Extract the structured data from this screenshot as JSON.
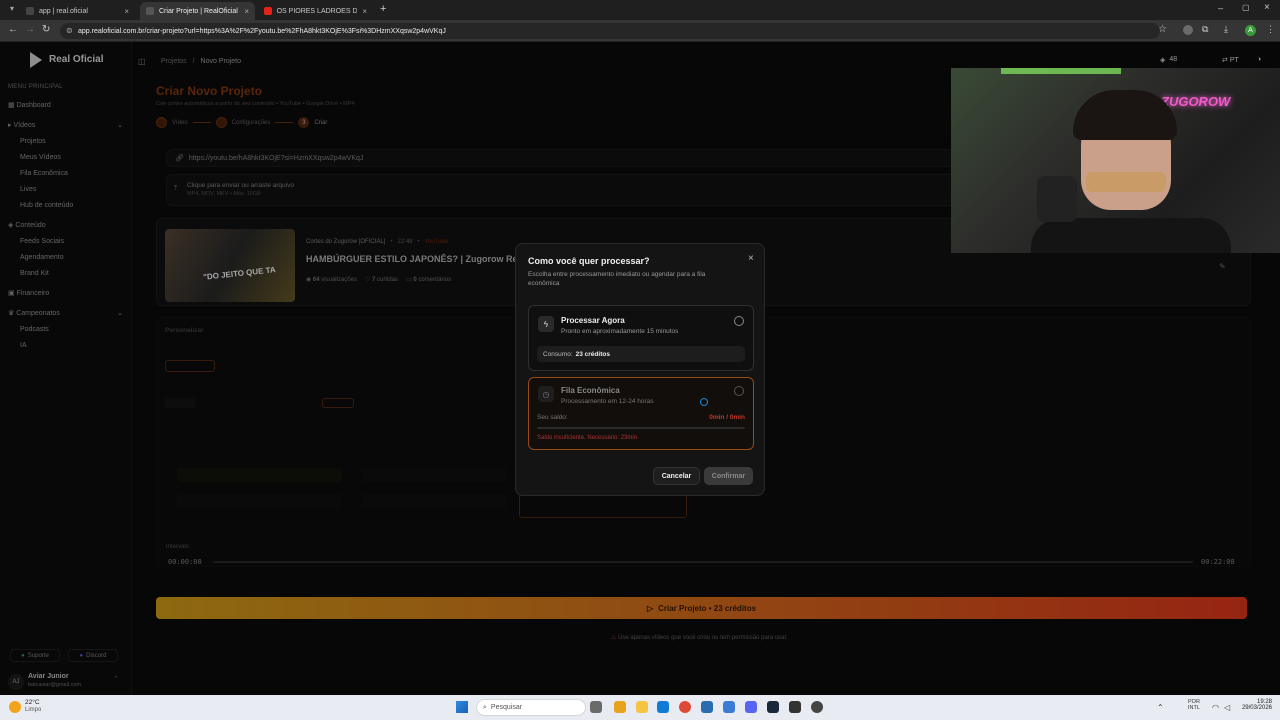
{
  "browser": {
    "tabs": [
      {
        "title": "app | real.oficial"
      },
      {
        "title": "Criar Projeto | RealOficial"
      },
      {
        "title": "OS PIORES LADRÕES DE BANC"
      }
    ],
    "url": "app.realoficial.com.br/criar-projeto?url=https%3A%2F%2Fyoutu.be%2FhA8hkt3KOjE%3Fsi%3DHzmXXqsw2p4wVKqJ",
    "profile_initial": "A"
  },
  "sidebar": {
    "brand": "Real Oficial",
    "section": "MENU PRINCIPAL",
    "items": [
      "Dashboard",
      "Vídeos",
      "Projetos",
      "Meus Vídeos",
      "Fila Econômica",
      "Lives",
      "Hub de conteúdo",
      "Conteúdo",
      "Feeds Sociais",
      "Agendamento",
      "Brand Kit",
      "Financeiro",
      "Campeonatos",
      "Podcasts",
      "IA"
    ],
    "support": "Suporte",
    "discord": "Discord",
    "user_initials": "AJ",
    "user_name": "Aviar Junior",
    "user_email": "batcaviar@gmail.com"
  },
  "topbar": {
    "breadcrumb_root": "Projetos",
    "breadcrumb_sep": "/",
    "breadcrumb_current": "Novo Projeto",
    "credits": "48",
    "lang": "PT"
  },
  "page": {
    "title": "Criar Novo Projeto",
    "subtitle": "Crie cortes automáticos a partir do seu conteúdo • YouTube • Google Drive • MP4",
    "steps": [
      "Vídeo",
      "Configurações",
      "Criar"
    ],
    "step3_num": "3",
    "link_value": "https://youtu.be/hA8hkt3KOjE?si=HzmXXqsw2p4wVKqJ",
    "upload_title": "Clique para enviar ou arraste arquivo",
    "upload_sub": "MP4, MOV, MKV • Máx. 10GB",
    "video_channel": "Cortes do Zugorow [OFICIAL]",
    "video_duration": "22:48",
    "video_source": "YouTube",
    "video_title": "HAMBÚRGUER ESTILO JAPONÊS? | Zugorow Rea",
    "views": "64",
    "views_label": "visualizações",
    "likes": "7",
    "likes_label": "curtidas",
    "comments": "0",
    "comments_label": "comentários",
    "thumb_caption": "\"DO JEITO QUE TA",
    "customize_label": "Personalizar",
    "interval_label": "Intervalo",
    "time_start": "00:00:00",
    "time_end": "00:22:08",
    "cta_label": "Criar Projeto • 23 créditos",
    "warning": "Use apenas vídeos que você criou ou tem permissão para usar."
  },
  "modal": {
    "title": "Como você quer processar?",
    "subtitle": "Escolha entre processamento imediato ou agendar para a fila econômica",
    "close": "×",
    "opt1_title": "Processar Agora",
    "opt1_sub": "Pronto em aproximadamente 15 minutos",
    "opt1_cost_label": "Consumo:",
    "opt1_cost_value": "23 créditos",
    "opt2_title": "Fila Econômica",
    "opt2_sub": "Processamento em 12-24 horas",
    "opt2_balance_label": "Seu saldo:",
    "opt2_balance_value": "0min / 0min",
    "opt2_error": "Saldo insuficiente. Necessário: 23min",
    "cancel": "Cancelar",
    "confirm": "Confirmar"
  },
  "webcam": {
    "sign": "ZUGOROW"
  },
  "taskbar": {
    "weather_temp": "22°C",
    "weather_desc": "Limpo",
    "search_placeholder": "Pesquisar",
    "lang1": "POR",
    "lang2": "INTL",
    "time": "19:28",
    "date": "29/03/2026"
  },
  "colors": {
    "accent": "#e0661e",
    "cta_start": "#d9a21a",
    "cta_end": "#e6381c",
    "danger": "#e0453a"
  }
}
